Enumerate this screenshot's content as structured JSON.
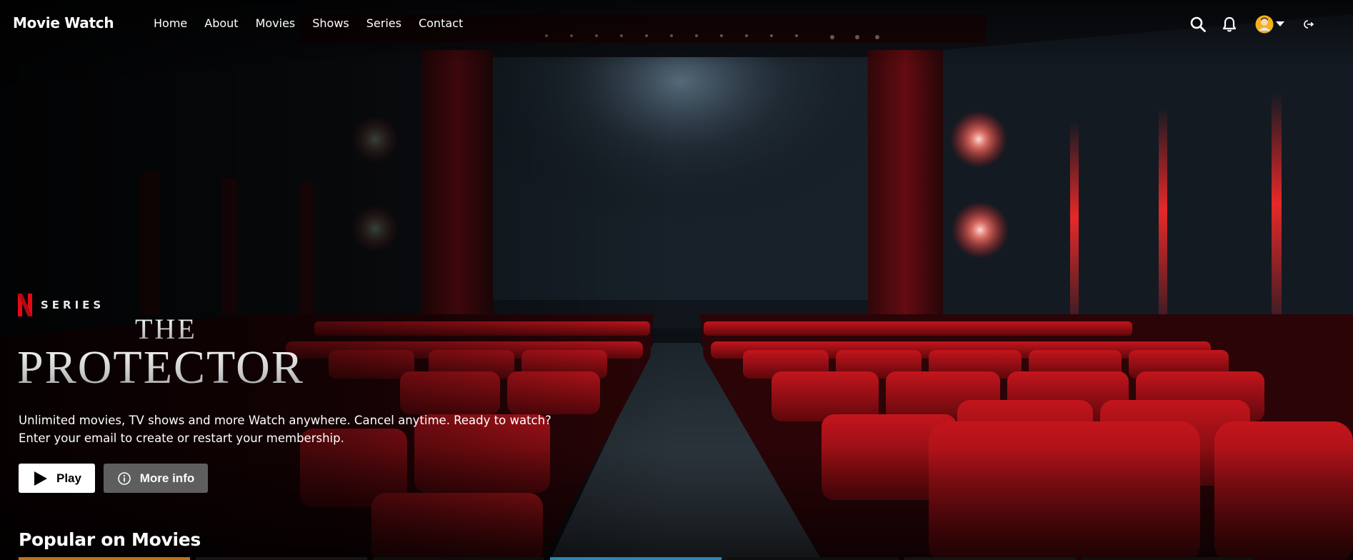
{
  "nav": {
    "brand": "Movie Watch",
    "links": [
      "Home",
      "About",
      "Movies",
      "Shows",
      "Series",
      "Contact"
    ],
    "icons": [
      "search-icon",
      "bell-icon",
      "avatar",
      "caret-down-icon",
      "logout-icon"
    ]
  },
  "hero": {
    "badge_letter": "N",
    "badge_label": "SERIES",
    "title_line1": "THE",
    "title_line2": "PROTECTOR",
    "description_line1": "Unlimited movies, TV shows and more Watch anywhere. Cancel anytime. Ready to watch?",
    "description_line2": "Enter your email to create or restart your membership.",
    "play_label": "Play",
    "more_label": "More info"
  },
  "section": {
    "title": "Popular on Movies"
  },
  "colors": {
    "brand_red": "#e50914",
    "seat_red": "#a3121a",
    "more_button": "#6e6e6e"
  }
}
